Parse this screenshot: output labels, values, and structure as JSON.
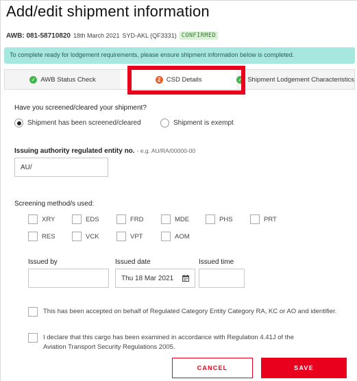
{
  "header": {
    "title": "Add/edit shipment information",
    "awb_label": "AWB: 081-58710820",
    "awb_date": "18th March 2021",
    "route": "SYD-AKL (QF3331)",
    "status_badge": "CONFIRMED"
  },
  "banner": {
    "text": "To complete ready for lodgement requirements, please ensure shipment information below is completed."
  },
  "tabs": [
    {
      "label": "AWB Status Check",
      "icon": "check-circle-icon"
    },
    {
      "label": "CSD Details",
      "icon": "step-number-icon",
      "step": "2"
    },
    {
      "label": "Shipment Lodgement Characteristics",
      "icon": "check-circle-icon"
    }
  ],
  "screening_question": {
    "label": "Have you screened/cleared your shipment?",
    "options": [
      "Shipment has been screened/cleared",
      "Shipment is exempt"
    ],
    "selected": 0
  },
  "issuing_authority": {
    "label": "Issuing authority regulated entity no.",
    "hint": "- e.g. AU/RA/00000-00",
    "value": "AU/"
  },
  "screening_methods": {
    "label": "Screening method/s used:",
    "row1": [
      "XRY",
      "EDS",
      "FRD",
      "MDE",
      "PHS",
      "PRT"
    ],
    "row2": [
      "RES",
      "VCK",
      "VPT",
      "AOM"
    ]
  },
  "issued": {
    "by_label": "Issued by",
    "date_label": "Issued date",
    "time_label": "Issued time",
    "by_value": "",
    "date_value": "Thu 18 Mar 2021",
    "time_value": ""
  },
  "declarations": {
    "accepted": "This has been accepted on behalf of Regulated Category Entity Category RA, KC or AO and identifier.",
    "declare_line1": "I declare that this cargo has been examined in accordance with Regulation 4.41J of the",
    "declare_line2": "Aviation Transport Security Regulations 2005."
  },
  "actions": {
    "cancel": "CANCEL",
    "save": "SAVE"
  },
  "colors": {
    "accent_red": "#e8001c",
    "banner_bg": "#a6e8e0",
    "success_green": "#3fb84a",
    "step_orange": "#f15a22"
  }
}
